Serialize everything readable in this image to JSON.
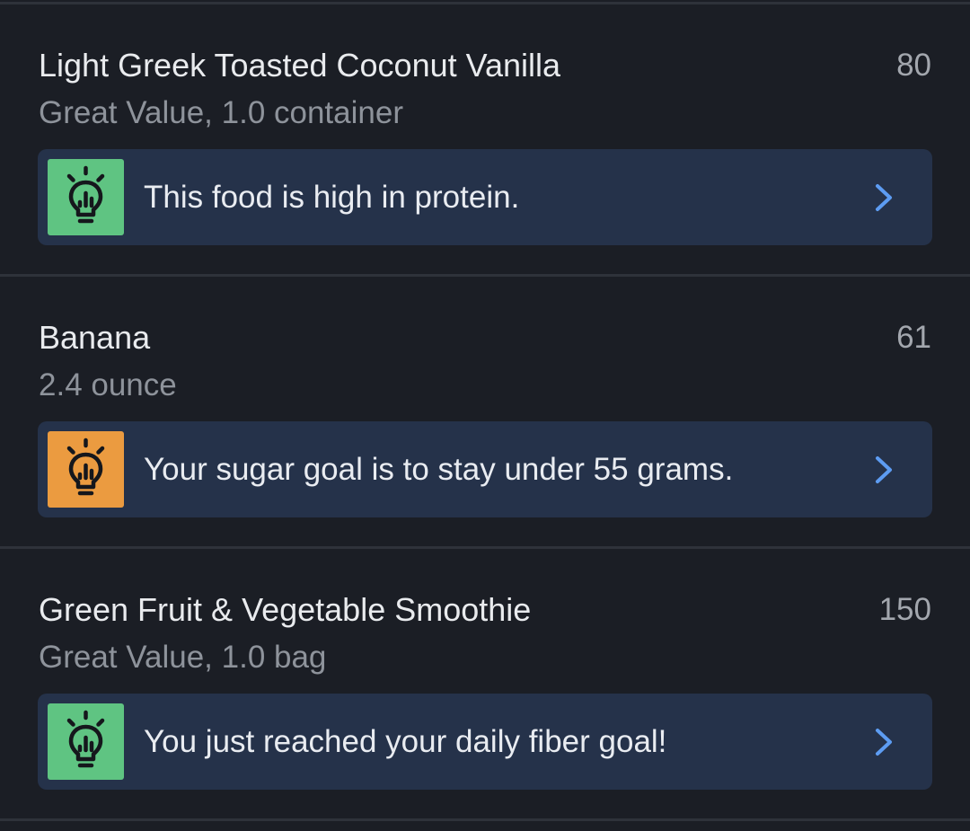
{
  "entries": [
    {
      "name": "Light Greek Toasted Coconut Vanilla",
      "serving": "Great Value, 1.0 container",
      "calories": "80",
      "insight": {
        "text": "This food is high in protein.",
        "icon": "lightbulb-insight-icon",
        "color": "#5fc482"
      }
    },
    {
      "name": "Banana",
      "serving": "2.4 ounce",
      "calories": "61",
      "insight": {
        "text": "Your sugar goal is to stay under 55 grams.",
        "icon": "lightbulb-insight-icon",
        "color": "#eb9b40"
      }
    },
    {
      "name": "Green Fruit & Vegetable Smoothie",
      "serving": "Great Value, 1.0 bag",
      "calories": "150",
      "insight": {
        "text": "You just reached your daily fiber goal!",
        "icon": "lightbulb-insight-icon",
        "color": "#5fc482"
      }
    }
  ],
  "colors": {
    "background": "#1b1e25",
    "card": "#25324a",
    "chevron": "#5d9cf2",
    "divider": "#2e323a"
  }
}
